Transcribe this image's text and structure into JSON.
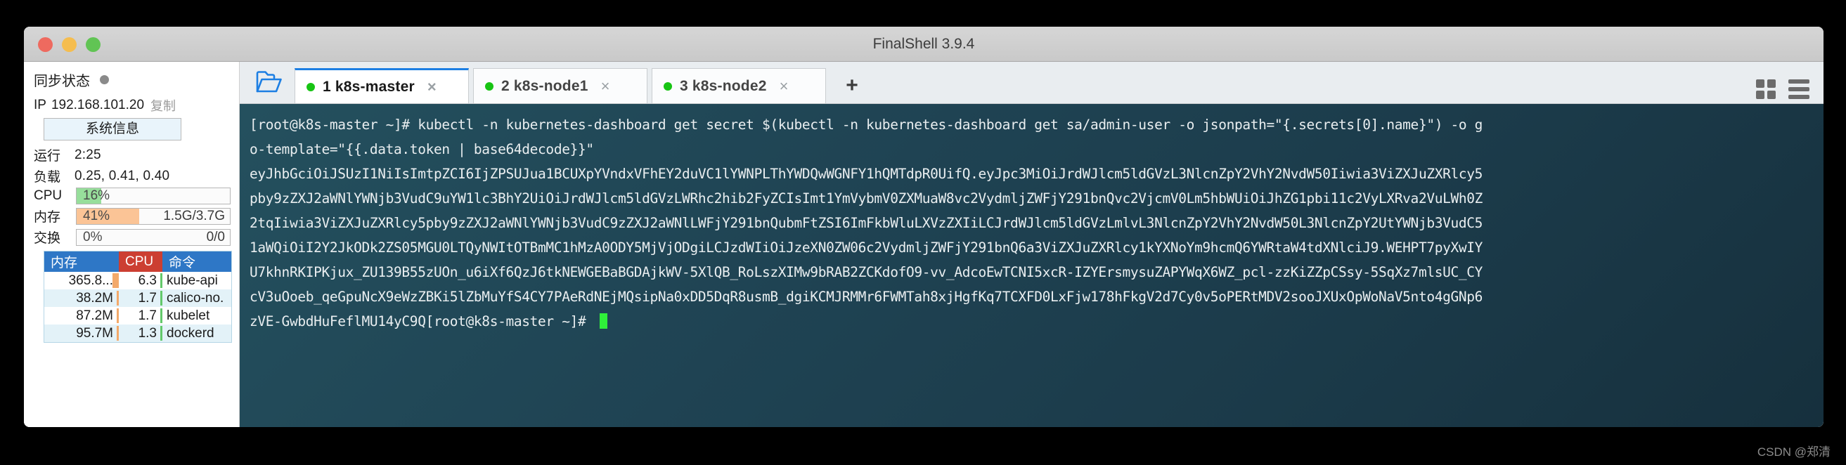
{
  "window": {
    "title": "FinalShell 3.9.4",
    "controls": {
      "close": "close",
      "minimize": "minimize",
      "maximize": "maximize"
    }
  },
  "sidebar": {
    "sync_label": "同步状态",
    "sync_status_color": "#8a8a8a",
    "ip_label": "IP",
    "ip_value": "192.168.101.20",
    "copy_label": "复制",
    "sysinfo_button": "系统信息",
    "uptime_label": "运行",
    "uptime_value": "2:25",
    "load_label": "负载",
    "load_value": "0.25, 0.41, 0.40",
    "cpu_label": "CPU",
    "cpu_percent": "16%",
    "cpu_fill": 16,
    "cpu_right": "",
    "mem_label": "内存",
    "mem_percent": "41%",
    "mem_fill": 41,
    "mem_right": "1.5G/3.7G",
    "swap_label": "交换",
    "swap_percent": "0%",
    "swap_fill": 0,
    "swap_right": "0/0",
    "process_table": {
      "headers": {
        "mem": "内存",
        "cpu": "CPU",
        "cmd": "命令"
      },
      "rows": [
        {
          "mem": "365.8...",
          "cpu": "6.3",
          "cmd": "kube-api"
        },
        {
          "mem": "38.2M",
          "cpu": "1.7",
          "cmd": "calico-no."
        },
        {
          "mem": "87.2M",
          "cpu": "1.7",
          "cmd": "kubelet"
        },
        {
          "mem": "95.7M",
          "cpu": "1.3",
          "cmd": "dockerd"
        }
      ]
    }
  },
  "tabbar": {
    "folder_icon": "folder-open-icon",
    "tabs": [
      {
        "index": "1",
        "label": "1 k8s-master",
        "active": true,
        "status_color": "#17c413",
        "close": "×"
      },
      {
        "index": "2",
        "label": "2 k8s-node1",
        "active": false,
        "status_color": "#17c413",
        "close": "×"
      },
      {
        "index": "3",
        "label": "3 k8s-node2",
        "active": false,
        "status_color": "#17c413",
        "close": "×"
      }
    ],
    "add_tab": "+",
    "grid_view_icon": "grid-view-icon",
    "list_view_icon": "list-view-icon"
  },
  "terminal": {
    "lines": [
      "[root@k8s-master ~]# kubectl -n kubernetes-dashboard get secret $(kubectl -n kubernetes-dashboard get sa/admin-user -o jsonpath=\"{.secrets[0].name}\") -o g",
      "o-template=\"{{.data.token | base64decode}}\"",
      "eyJhbGciOiJSUzI1NiIsImtpZCI6IjZPSUJua1BCUXpYVndxVFhEY2duVC1lYWNPLThYWDQwWGNFY1hQMTdpR0UifQ.eyJpc3MiOiJrdWJlcm5ldGVzL3NlcnZpY2VhY2NvdW50Iiwia3ViZXJuZXRlcy5",
      "pby9zZXJ2aWNlYWNjb3VudC9uYW1lc3BhY2UiOiJrdWJlcm5ldGVzLWRhc2hib2FyZCIsImt1YmVybmV0ZXMuaW8vc2VydmljZWFjY291bnQvc2VjcmV0Lm5hbWUiOiJhZG1pbi11c2VyLXRva2VuLWh0Z",
      "2tqIiwia3ViZXJuZXRlcy5pby9zZXJ2aWNlYWNjb3VudC9zZXJ2aWNlLWFjY291bnQubmFtZSI6ImFkbWluLXVzZXIiLCJrdWJlcm5ldGVzLmlvL3NlcnZpY2VhY2NvdW50L3NlcnZpY2UtYWNjb3VudC5",
      "1aWQiOiI2Y2JkODk2ZS05MGU0LTQyNWItOTBmMC1hMzA0ODY5MjVjODgiLCJzdWIiOiJzeXN0ZW06c2VydmljZWFjY291bnQ6a3ViZXJuZXRlcy1kYXNoYm9hcmQ6YWRtaW4tdXNlciJ9.WEHPT7pyXwIY",
      "U7khnRKIPKjux_ZU139B55zUOn_u6iXf6QzJ6tkNEWGEBaBGDAjkWV-5XlQB_RoLszXIMw9bRAB2ZCKdofO9-vv_AdcoEwTCNI5xcR-IZYErsmysuZAPYWqX6WZ_pcl-zzKiZZpCSsy-5SqXz7mlsUC_CY",
      "cV3uOoeb_qeGpuNcX9eWzZBKi5lZbMuYfS4CY7PAeRdNEjMQsipNa0xDD5DqR8usmB_dgiKCMJRMMr6FWMTah8xjHgfKq7TCXFD0LxFjw178hFkgV2d7Cy0v5oPERtMDV2sooJXUxOpWoNaV5nto4gGNp6",
      "zVE-GwbdHuFeflMU14yC9Q[root@k8s-master ~]# "
    ],
    "cursor": "block-cursor"
  },
  "watermark": "CSDN @郑清"
}
